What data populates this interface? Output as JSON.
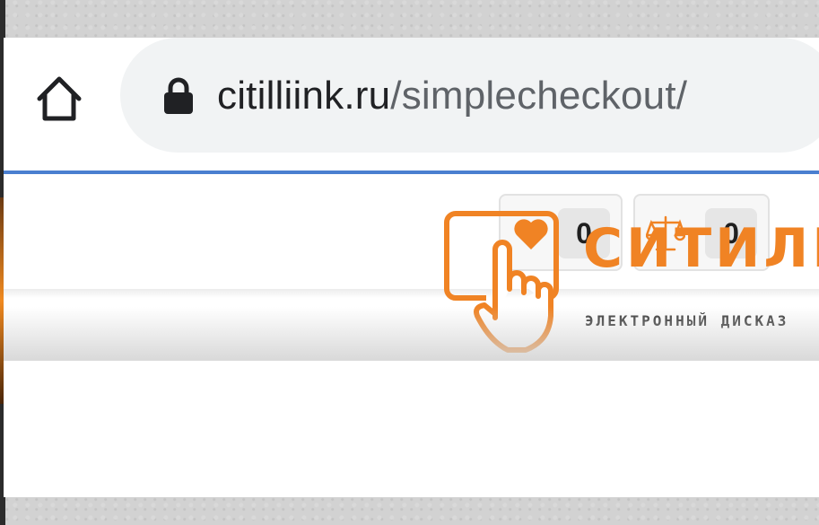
{
  "browser": {
    "url_domain": "citilliink.ru",
    "url_path": "/simplecheckout/",
    "home_icon": "home-icon",
    "lock_icon": "lock-icon"
  },
  "header": {
    "wishlist": {
      "icon": "heart-icon",
      "count": "0"
    },
    "compare": {
      "icon": "scales-icon",
      "count": "0"
    }
  },
  "logo": {
    "title": "СИТИЛИ",
    "subtitle": "ЭЛЕКТРОННЫЙ ДИСКАЗ"
  },
  "colors": {
    "accent": "#f08324",
    "progress": "#4a7fd0",
    "pill": "#f1f3f4"
  }
}
